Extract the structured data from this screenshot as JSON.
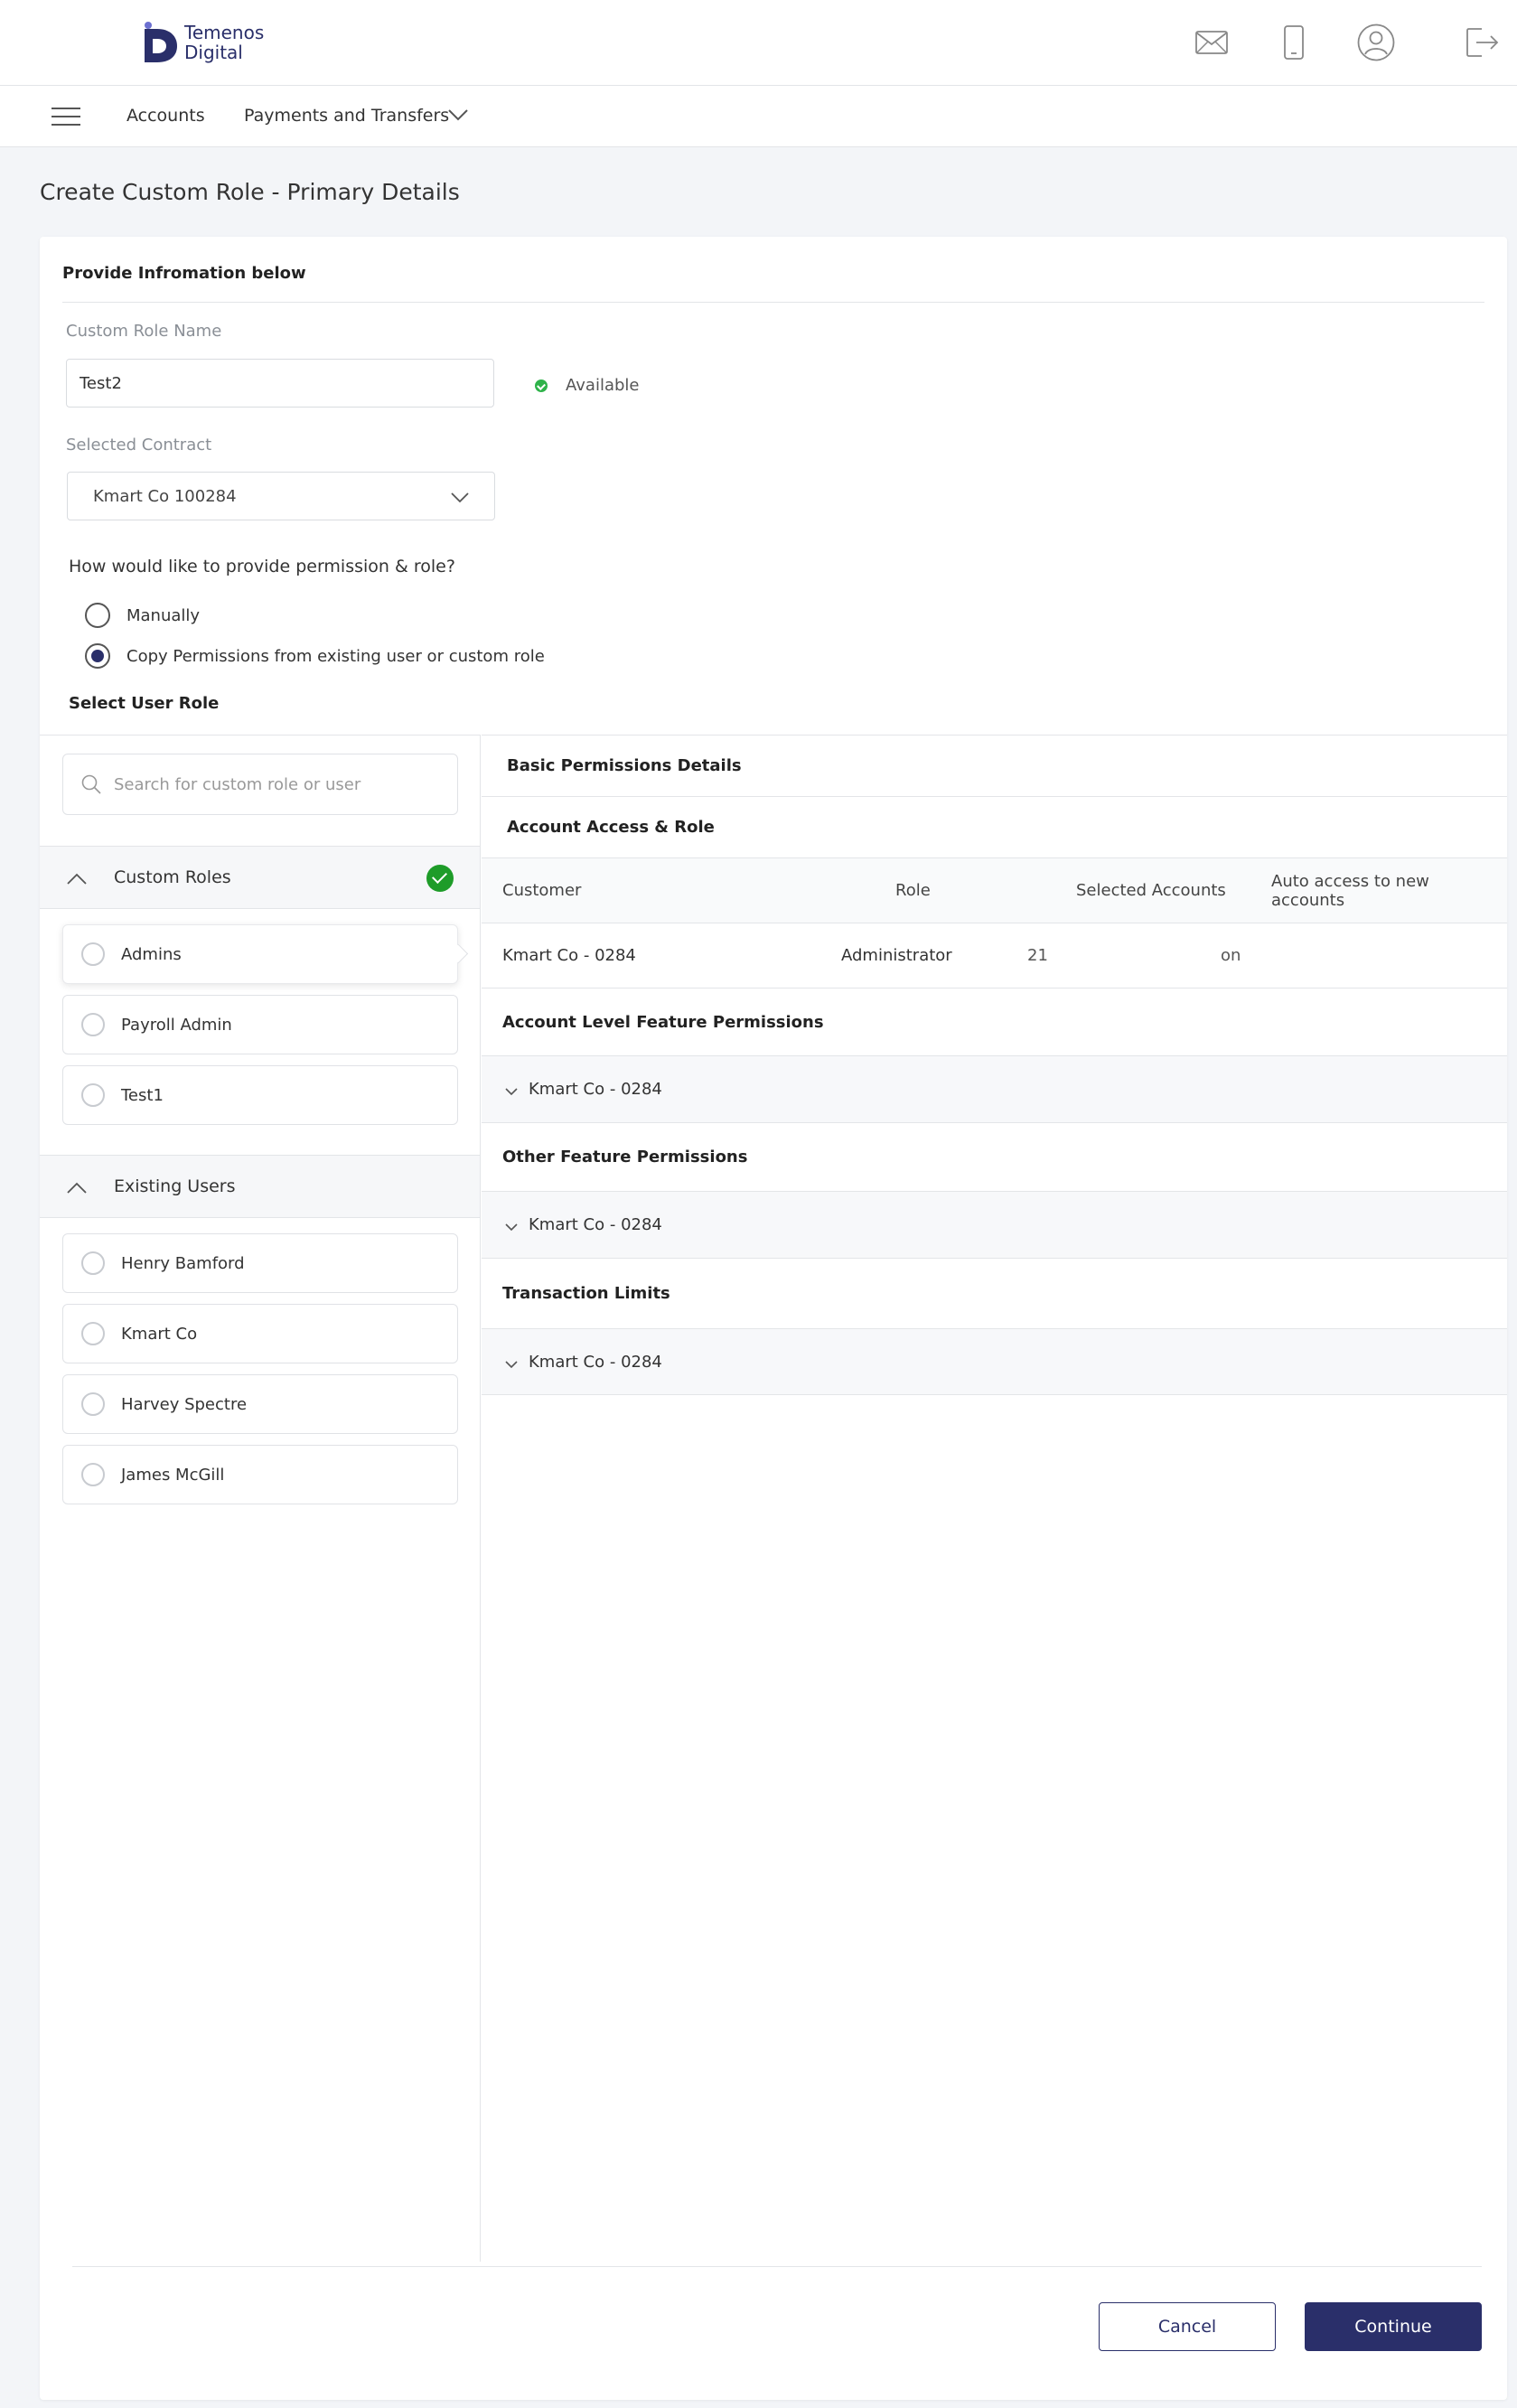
{
  "header": {
    "brand_line1": "Temenos",
    "brand_line2": "Digital",
    "icons": [
      "mail-icon",
      "mobile-icon",
      "profile-icon",
      "logout-icon"
    ]
  },
  "nav": {
    "accounts": "Accounts",
    "payments": "Payments and Transfers"
  },
  "page": {
    "title": "Create Custom Role - Primary Details"
  },
  "form": {
    "section_title": "Provide Infromation below",
    "role_name_label": "Custom Role Name",
    "role_name_value": "Test2",
    "availability": "Available",
    "contract_label": "Selected Contract",
    "contract_value": "Kmart Co 100284",
    "question": "How would like to provide permission & role?",
    "option_manual": "Manually",
    "option_copy": "Copy Permissions from existing user or custom role",
    "selected_option": "copy",
    "select_role_title": "Select User Role"
  },
  "left": {
    "search_placeholder": "Search for custom role or user",
    "custom_roles_title": "Custom Roles",
    "custom_roles": [
      "Admins",
      "Payroll Admin",
      "Test1"
    ],
    "existing_users_title": "Existing Users",
    "existing_users": [
      "Henry Bamford",
      "Kmart Co",
      "Harvey Spectre",
      "James McGill"
    ]
  },
  "right": {
    "basic_title": "Basic Permissions Details",
    "access_title": "Account Access & Role",
    "columns": [
      "Customer",
      "Role",
      "Selected Accounts",
      "Auto access to new accounts"
    ],
    "row": {
      "customer": "Kmart Co - 0284",
      "role": "Administrator",
      "accounts": "21",
      "auto": "on"
    },
    "account_level_title": "Account Level Feature Permissions",
    "account_level_item": "Kmart Co - 0284",
    "other_title": "Other Feature Permissions",
    "other_item": "Kmart Co - 0284",
    "limits_title": "Transaction Limits",
    "limits_item": "Kmart Co - 0284"
  },
  "footer": {
    "cancel": "Cancel",
    "continue": "Continue"
  },
  "colors": {
    "primary": "#2a2f6a",
    "success": "#1e9c29"
  }
}
